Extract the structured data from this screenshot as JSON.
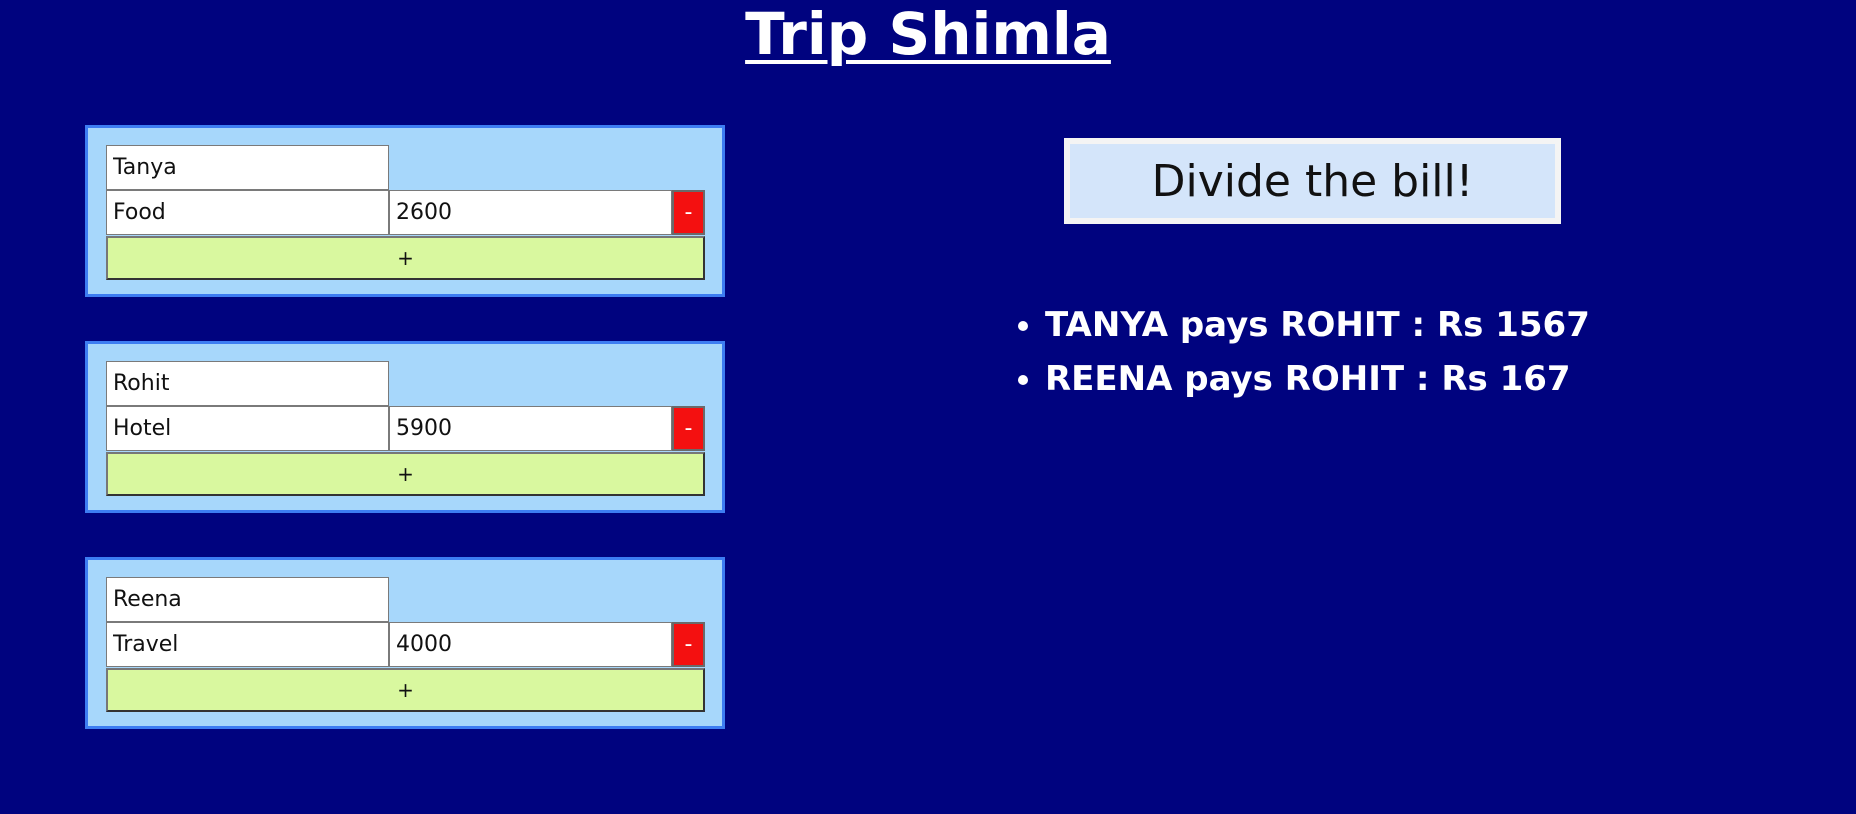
{
  "page": {
    "title": "Trip Shimla"
  },
  "persons": [
    {
      "name": "Tanya",
      "item": "Food",
      "amount": "2600",
      "remove_label": "-",
      "add_label": "+"
    },
    {
      "name": "Rohit",
      "item": "Hotel",
      "amount": "5900",
      "remove_label": "-",
      "add_label": "+"
    },
    {
      "name": "Reena",
      "item": "Travel",
      "amount": "4000",
      "remove_label": "-",
      "add_label": "+"
    }
  ],
  "divide_button": {
    "label": "Divide the bill!"
  },
  "settlements": [
    "TANYA pays ROHIT : Rs 1567",
    "REENA pays ROHIT : Rs 167"
  ],
  "colors": {
    "background": "#00037f",
    "card_background": "#a7d7fb",
    "card_border": "#3d7df2",
    "remove_button": "#f41010",
    "add_button": "#d9f89f",
    "divide_button": "#d4e5fa"
  }
}
